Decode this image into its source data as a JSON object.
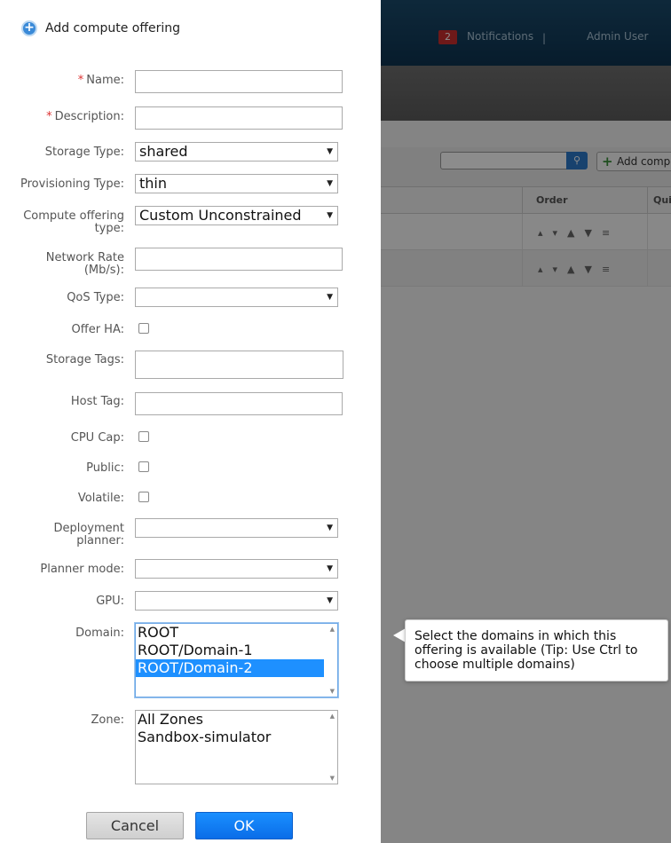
{
  "header": {
    "notifications_count": "2",
    "notifications_label": "Notifications",
    "separator": "|",
    "user_label": "Admin User"
  },
  "background": {
    "add_button_label": "Add compu",
    "column_order": "Order",
    "column_quick": "Qui",
    "row_order_icons": "▴▾▲▼≡"
  },
  "dialog": {
    "title": "Add compute offering",
    "required_marker": "*",
    "fields": {
      "name": {
        "label": "Name:",
        "value": ""
      },
      "description": {
        "label": "Description:",
        "value": ""
      },
      "storage_type": {
        "label": "Storage Type:",
        "value": "shared"
      },
      "provisioning_type": {
        "label": "Provisioning Type:",
        "value": "thin"
      },
      "compute_offering_type": {
        "label_line1": "Compute offering",
        "label_line2": "type:",
        "value": "Custom Unconstrained"
      },
      "network_rate": {
        "label_line1": "Network Rate",
        "label_line2": "(Mb/s):",
        "value": ""
      },
      "qos_type": {
        "label": "QoS Type:",
        "value": ""
      },
      "offer_ha": {
        "label": "Offer HA:",
        "checked": false
      },
      "storage_tags": {
        "label": "Storage Tags:",
        "value": ""
      },
      "host_tag": {
        "label": "Host Tag:",
        "value": ""
      },
      "cpu_cap": {
        "label": "CPU Cap:",
        "checked": false
      },
      "public": {
        "label": "Public:",
        "checked": false
      },
      "volatile": {
        "label": "Volatile:",
        "checked": false
      },
      "deployment_planner": {
        "label_line1": "Deployment",
        "label_line2": "planner:",
        "value": ""
      },
      "planner_mode": {
        "label": "Planner mode:",
        "value": ""
      },
      "gpu": {
        "label": "GPU:",
        "value": ""
      },
      "domain": {
        "label": "Domain:",
        "options": [
          "ROOT",
          "ROOT/Domain-1",
          "ROOT/Domain-2"
        ],
        "selected": "ROOT/Domain-2"
      },
      "zone": {
        "label": "Zone:",
        "options": [
          "All Zones",
          "Sandbox-simulator"
        ]
      }
    },
    "buttons": {
      "cancel": "Cancel",
      "ok": "OK"
    },
    "tooltip": "Select the domains in which this offering is available (Tip: Use Ctrl to choose multiple domains)"
  },
  "colors": {
    "header_bg": "#0e3350",
    "badge_red": "#c92e2e",
    "ok_blue": "#0a6de8",
    "selected_option": "#1e90ff",
    "required_red": "#dd3333"
  }
}
